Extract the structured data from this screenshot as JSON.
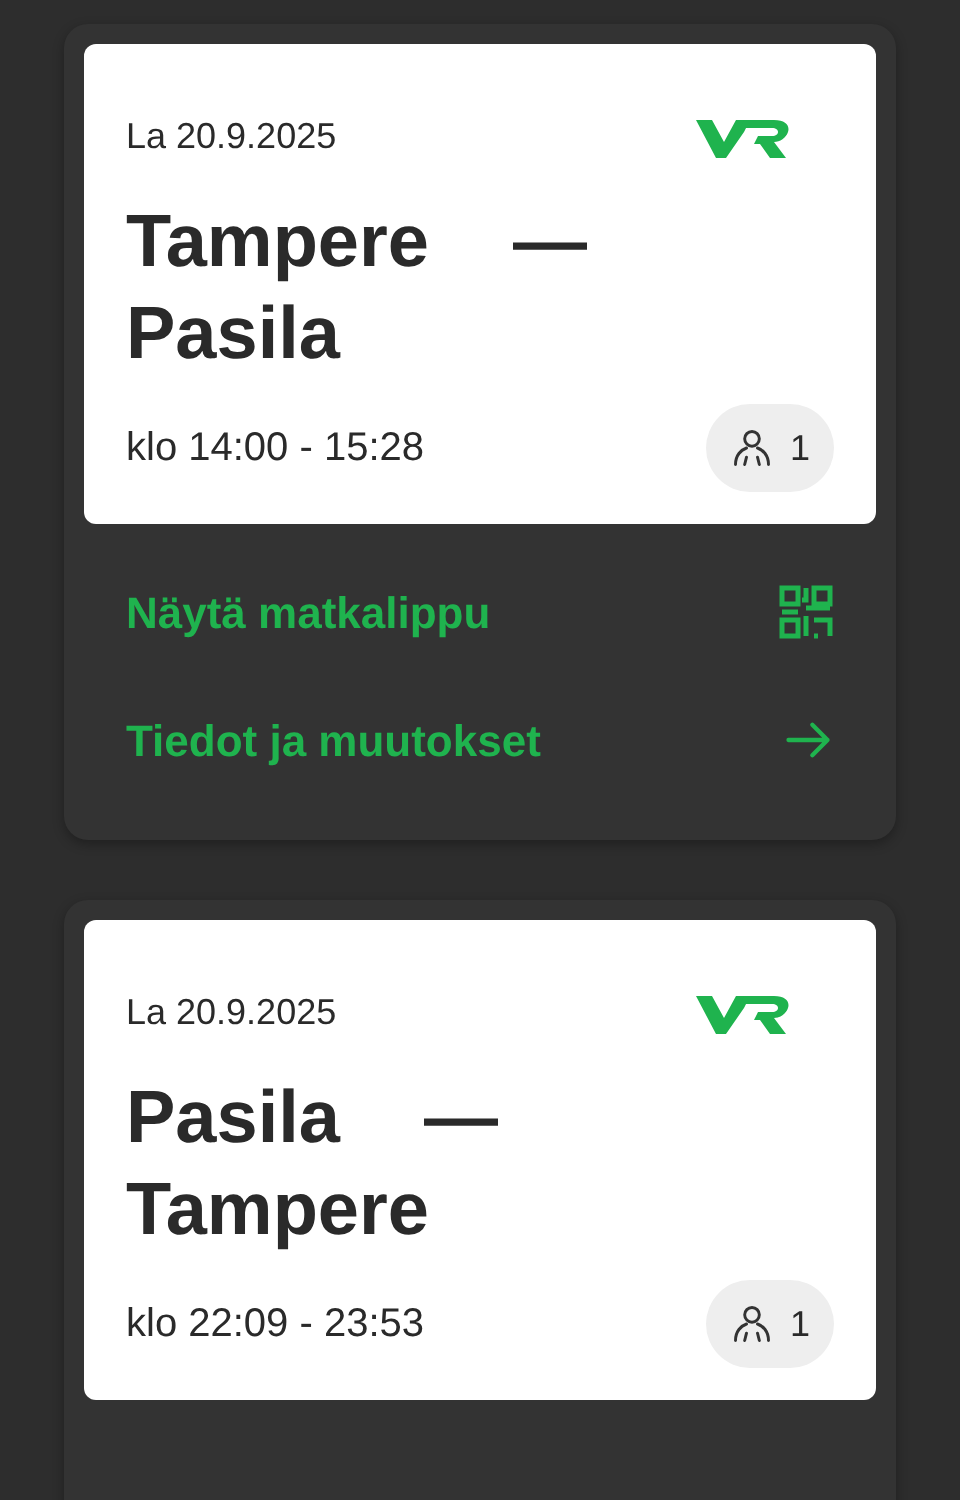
{
  "trips": [
    {
      "date": "La 20.9.2025",
      "from": "Tampere",
      "separator": "—",
      "to": "Pasila",
      "time": "klo 14:00 - 15:28",
      "passengers": "1",
      "actions": [
        {
          "kind": "ticket",
          "label": "Näytä matkalippu"
        },
        {
          "kind": "details",
          "label": "Tiedot ja muutokset"
        }
      ]
    },
    {
      "date": "La 20.9.2025",
      "from": "Pasila",
      "separator": "—",
      "to": "Tampere",
      "time": "klo 22:09 - 23:53",
      "passengers": "1"
    }
  ]
}
